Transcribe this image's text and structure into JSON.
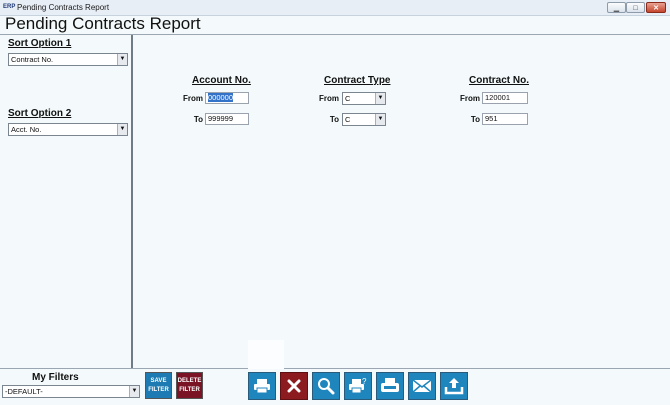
{
  "window": {
    "icon_text": "ERP",
    "title": "Pending Contracts Report",
    "min_glyph": "▁",
    "max_glyph": "□",
    "close_glyph": "✕"
  },
  "page": {
    "title": "Pending Contracts Report"
  },
  "sort": {
    "option1_label": "Sort Option 1",
    "option1_value": "Contract No.",
    "option2_label": "Sort Option 2",
    "option2_value": "Acct. No."
  },
  "filters": {
    "account": {
      "heading": "Account No.",
      "from_label": "From",
      "from_value": "000000",
      "to_label": "To",
      "to_value": "999999"
    },
    "contract_type": {
      "heading": "Contract Type",
      "from_label": "From",
      "from_value": "C",
      "to_label": "To",
      "to_value": "C"
    },
    "contract_no": {
      "heading": "Contract No.",
      "from_label": "From",
      "from_value": "120001",
      "to_label": "To",
      "to_value": "951"
    }
  },
  "footer": {
    "my_filters_label": "My Filters",
    "my_filters_value": "-DEFAULT-",
    "save_filter_line1": "SAVE",
    "save_filter_line2": "FILTER",
    "delete_filter_line1": "DELETE",
    "delete_filter_line2": "FILTER"
  },
  "toolbar": {
    "icons": [
      "print-icon",
      "cancel-icon",
      "search-icon",
      "print-preview-icon",
      "fax-icon",
      "email-icon",
      "export-icon"
    ]
  },
  "colors": {
    "toolbar_blue": "#1f86bd",
    "cancel_red": "#8b1b1f",
    "delete_red": "#7a1425",
    "save_blue": "#1d7ab2"
  }
}
